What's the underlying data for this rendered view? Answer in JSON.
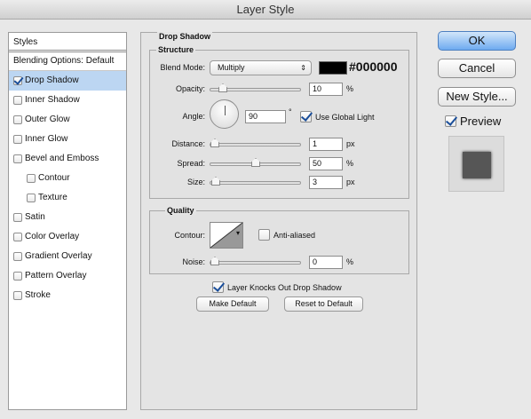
{
  "window": {
    "title": "Layer Style"
  },
  "styles_list": {
    "header": "Styles",
    "items": [
      {
        "label": "Blending Options: Default",
        "checkbox": false,
        "checked": false,
        "selected": false
      },
      {
        "label": "Drop Shadow",
        "checkbox": true,
        "checked": true,
        "selected": true
      },
      {
        "label": "Inner Shadow",
        "checkbox": true,
        "checked": false,
        "selected": false
      },
      {
        "label": "Outer Glow",
        "checkbox": true,
        "checked": false,
        "selected": false
      },
      {
        "label": "Inner Glow",
        "checkbox": true,
        "checked": false,
        "selected": false
      },
      {
        "label": "Bevel and Emboss",
        "checkbox": true,
        "checked": false,
        "selected": false
      },
      {
        "label": "Contour",
        "checkbox": true,
        "checked": false,
        "selected": false
      },
      {
        "label": "Texture",
        "checkbox": true,
        "checked": false,
        "selected": false
      },
      {
        "label": "Satin",
        "checkbox": true,
        "checked": false,
        "selected": false
      },
      {
        "label": "Color Overlay",
        "checkbox": true,
        "checked": false,
        "selected": false
      },
      {
        "label": "Gradient Overlay",
        "checkbox": true,
        "checked": false,
        "selected": false
      },
      {
        "label": "Pattern Overlay",
        "checkbox": true,
        "checked": false,
        "selected": false
      },
      {
        "label": "Stroke",
        "checkbox": true,
        "checked": false,
        "selected": false
      }
    ]
  },
  "drop_shadow": {
    "title": "Drop Shadow",
    "structure": {
      "title": "Structure",
      "blend_mode_label": "Blend Mode:",
      "blend_mode_value": "Multiply",
      "color_hex": "#000000",
      "opacity_label": "Opacity:",
      "opacity_value": "10",
      "opacity_unit": "%",
      "opacity_level": 0.1,
      "angle_label": "Angle:",
      "angle_value": "90",
      "angle_unit": "°",
      "use_global_light_label": "Use Global Light",
      "use_global_light_checked": true,
      "distance_label": "Distance:",
      "distance_value": "1",
      "distance_unit": "px",
      "distance_level": 0.0,
      "spread_label": "Spread:",
      "spread_value": "50",
      "spread_unit": "%",
      "spread_level": 0.5,
      "size_label": "Size:",
      "size_value": "3",
      "size_unit": "px",
      "size_level": 0.01
    },
    "quality": {
      "title": "Quality",
      "contour_label": "Contour:",
      "anti_aliased_label": "Anti-aliased",
      "anti_aliased_checked": false,
      "noise_label": "Noise:",
      "noise_value": "0",
      "noise_unit": "%",
      "noise_level": 0.0
    },
    "knocks_out_label": "Layer Knocks Out Drop Shadow",
    "knocks_out_checked": true,
    "make_default_label": "Make Default",
    "reset_default_label": "Reset to Default"
  },
  "buttons": {
    "ok": "OK",
    "cancel": "Cancel",
    "new_style": "New Style...",
    "preview_label": "Preview",
    "preview_checked": true
  },
  "colors": {
    "accent": "#6eaaf0",
    "selected_row": "#bcd6f2",
    "shadow_color": "#000000"
  }
}
